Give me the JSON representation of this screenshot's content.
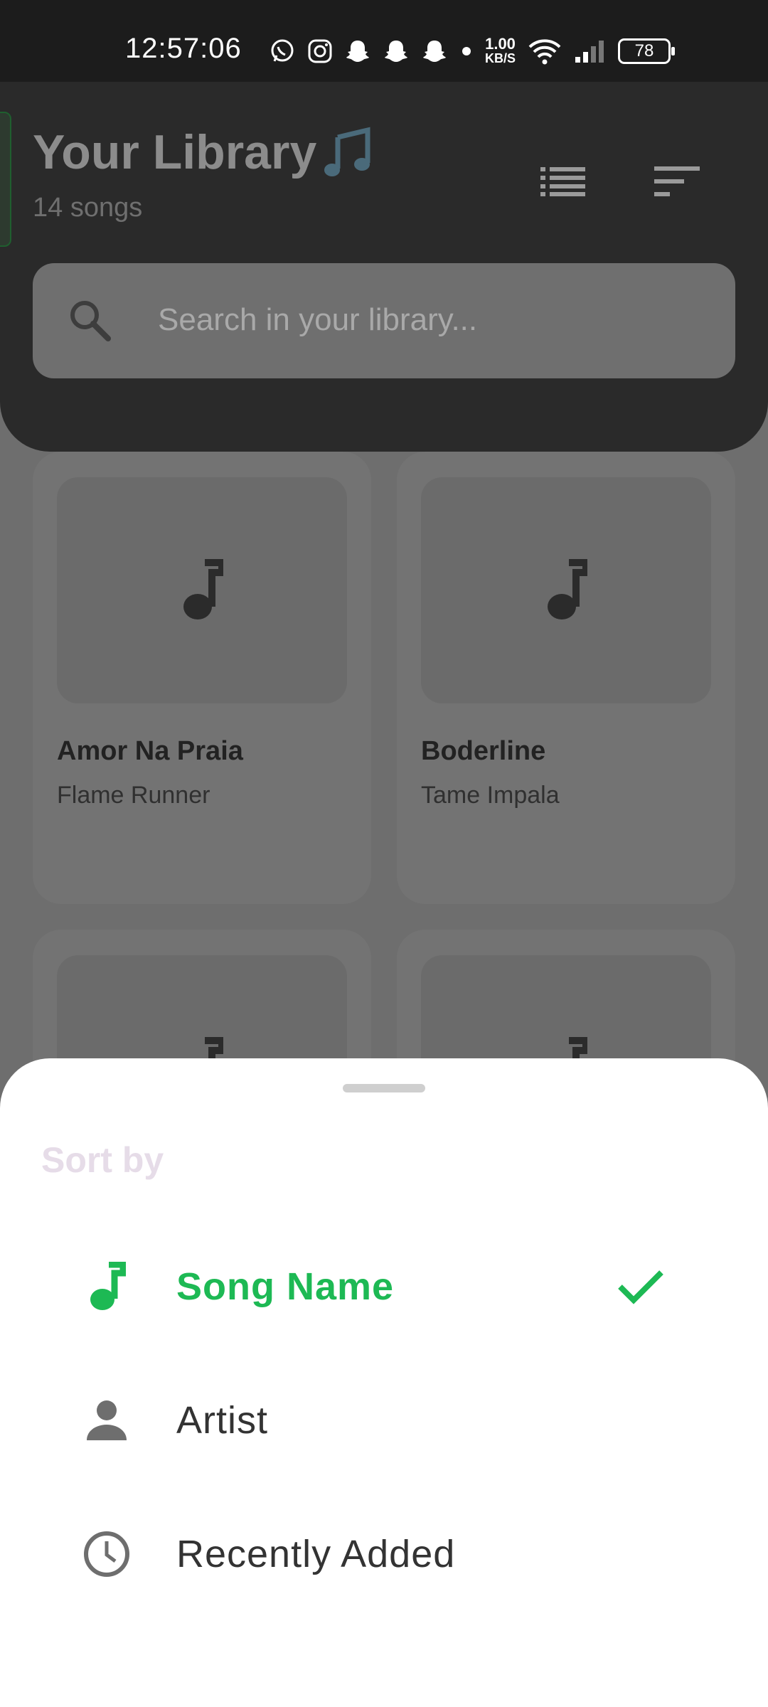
{
  "status_bar": {
    "time": "12:57:06",
    "net_speed_value": "1.00",
    "net_speed_unit": "KB/S",
    "battery": "78",
    "icons": [
      "whatsapp-icon",
      "instagram-icon",
      "snapchat-icon",
      "snapchat-icon",
      "snapchat-icon",
      "dot-icon",
      "wifi-icon",
      "signal-icon",
      "battery-icon"
    ]
  },
  "header": {
    "title": "Your Library",
    "title_icon": "music-note-icon",
    "song_count": "14 songs",
    "actions": [
      "list-view-icon",
      "sort-icon"
    ]
  },
  "search": {
    "placeholder": "Search in your library...",
    "value": ""
  },
  "songs": [
    {
      "title": "Amor Na Praia",
      "artist": "Flame Runner"
    },
    {
      "title": "Boderline",
      "artist": "Tame Impala"
    },
    {
      "title": "",
      "artist": ""
    },
    {
      "title": "",
      "artist": ""
    }
  ],
  "sort_sheet": {
    "title": "Sort by",
    "options": [
      {
        "label": "Song Name",
        "icon": "music-note-icon",
        "selected": true
      },
      {
        "label": "Artist",
        "icon": "person-icon",
        "selected": false
      },
      {
        "label": "Recently Added",
        "icon": "clock-icon",
        "selected": false
      }
    ]
  },
  "colors": {
    "accent": "#1db954",
    "sheet_bg": "#ffffff",
    "header_bg": "#2a2a2a",
    "scrim": "#6e6e6e"
  }
}
